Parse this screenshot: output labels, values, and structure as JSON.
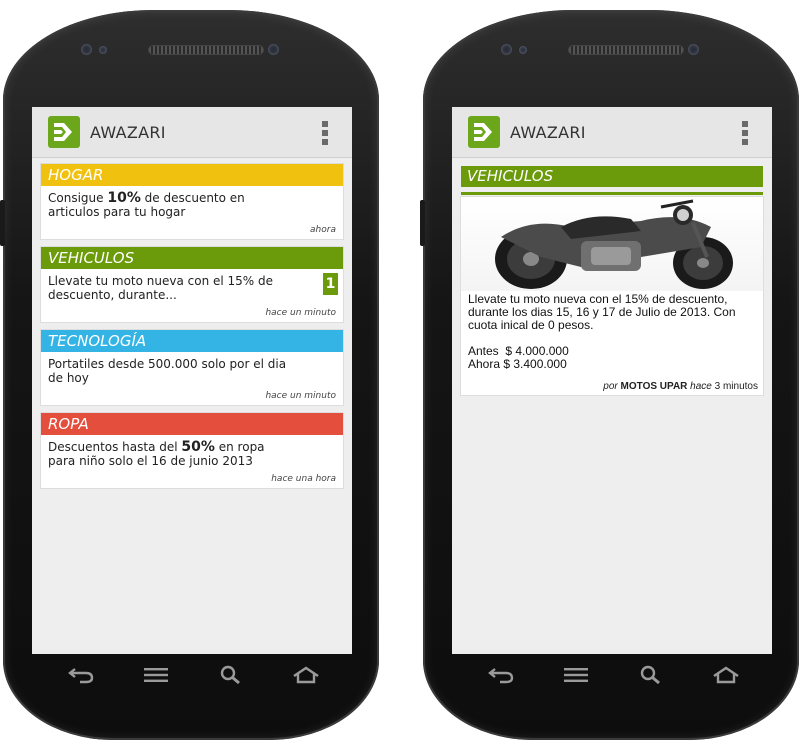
{
  "app": {
    "name": "AWAZARI"
  },
  "list_screen": {
    "cards": [
      {
        "category": "HOGAR",
        "color": "#f0c20f",
        "text_pre": "Consigue ",
        "text_bold": "10%",
        "text_post": " de descuento en articulos para tu hogar",
        "time": "ahora",
        "badge": ""
      },
      {
        "category": "VEHICULOS",
        "color": "#6b9a0b",
        "text_pre": "Llevate tu moto nueva con el 15% de descuento, durante...",
        "text_bold": "",
        "text_post": "",
        "time": "hace un minuto",
        "badge": "1"
      },
      {
        "category": "TECNOLOGÍA",
        "color": "#33b4e4",
        "text_pre": "Portatiles desde 500.000 solo por el dia de hoy",
        "text_bold": "",
        "text_post": "",
        "time": "hace un minuto",
        "badge": ""
      },
      {
        "category": "ROPA",
        "color": "#e44e3d",
        "text_pre": "Descuentos hasta del ",
        "text_bold": "50%",
        "text_post": " en ropa para niño solo el 16 de junio 2013",
        "time": "hace una hora",
        "badge": ""
      }
    ]
  },
  "detail_screen": {
    "category": "VEHICULOS",
    "image_icon": "motorcycle-photo",
    "description": "Llevate tu moto nueva con el 15% de descuento, durante los dias 15, 16 y 17 de Julio de 2013. Con cuota inical de 0 pesos.",
    "price_before": "Antes  $ 4.000.000",
    "price_now": "Ahora $ 3.400.000",
    "by_prefix": "por",
    "merchant": "MOTOS UPAR",
    "time_prefix": "hace",
    "time_value": "3 minutos"
  },
  "navbar_icons": [
    "back-icon",
    "menu-icon",
    "search-icon",
    "home-icon"
  ]
}
